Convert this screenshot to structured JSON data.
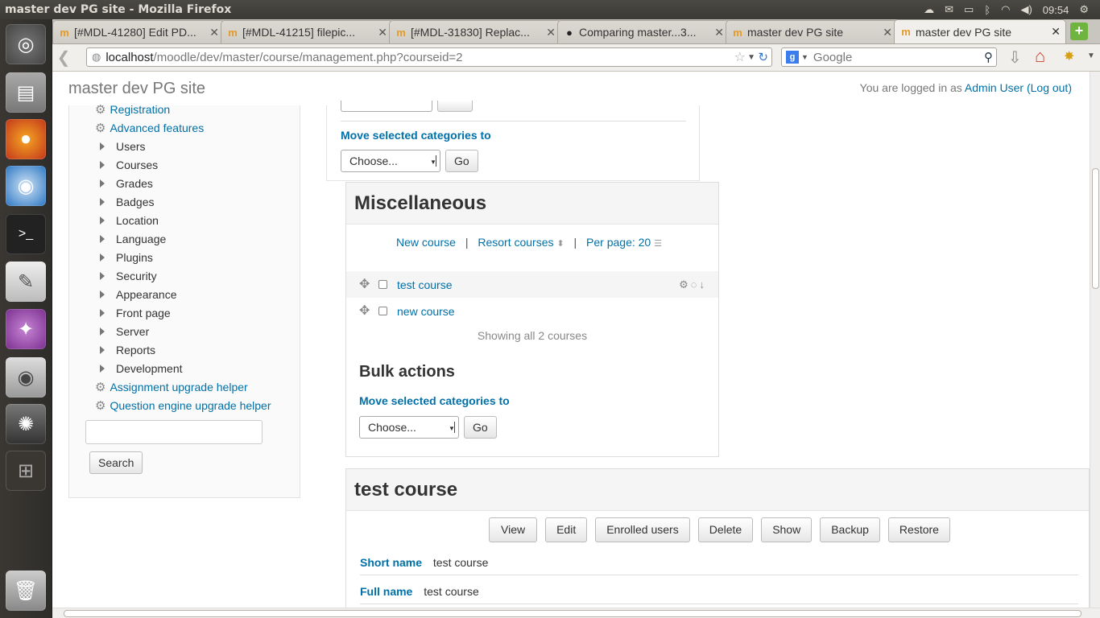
{
  "window": {
    "title": "master dev PG site - Mozilla Firefox"
  },
  "tray": {
    "time": "09:54"
  },
  "tabs": [
    {
      "label": "[#MDL-41280] Edit PD...",
      "icon": "moodle-tracker-icon"
    },
    {
      "label": "[#MDL-41215] filepic...",
      "icon": "moodle-tracker-icon"
    },
    {
      "label": "[#MDL-31830] Replac...",
      "icon": "moodle-tracker-icon"
    },
    {
      "label": "Comparing master...3...",
      "icon": "github-icon"
    },
    {
      "label": "master dev PG site",
      "icon": "moodle-icon"
    },
    {
      "label": "master dev PG site",
      "icon": "moodle-icon",
      "active": true
    }
  ],
  "nav": {
    "url_host": "localhost",
    "url_path": "/moodle/dev/master/course/management.php?courseid=2",
    "search_placeholder": "Google"
  },
  "header": {
    "site_name": "master dev PG site",
    "login_prefix": "You are logged in as ",
    "user": "Admin User",
    "logout": "(Log out)"
  },
  "admin_tree": [
    {
      "label": "Registration",
      "kind": "link"
    },
    {
      "label": "Advanced features",
      "kind": "link"
    },
    {
      "label": "Users",
      "kind": "folder"
    },
    {
      "label": "Courses",
      "kind": "folder"
    },
    {
      "label": "Grades",
      "kind": "folder"
    },
    {
      "label": "Badges",
      "kind": "folder"
    },
    {
      "label": "Location",
      "kind": "folder"
    },
    {
      "label": "Language",
      "kind": "folder"
    },
    {
      "label": "Plugins",
      "kind": "folder"
    },
    {
      "label": "Security",
      "kind": "folder"
    },
    {
      "label": "Appearance",
      "kind": "folder"
    },
    {
      "label": "Front page",
      "kind": "folder"
    },
    {
      "label": "Server",
      "kind": "folder"
    },
    {
      "label": "Reports",
      "kind": "folder"
    },
    {
      "label": "Development",
      "kind": "folder"
    },
    {
      "label": "Assignment upgrade helper",
      "kind": "link"
    },
    {
      "label": "Question engine upgrade helper",
      "kind": "link"
    }
  ],
  "admin_search": {
    "button": "Search"
  },
  "categories_panel": {
    "move_label": "Move selected categories to",
    "select_value": "Choose...",
    "go": "Go"
  },
  "misc_panel": {
    "title": "Miscellaneous",
    "new_course": "New course",
    "resort": "Resort courses",
    "per_page": "Per page: 20",
    "courses": [
      "test course",
      "new course"
    ],
    "showing": "Showing all 2 courses",
    "bulk_title": "Bulk actions",
    "move_label": "Move selected categories to",
    "select_value": "Choose...",
    "go": "Go"
  },
  "detail_panel": {
    "title": "test course",
    "buttons": [
      "View",
      "Edit",
      "Enrolled users",
      "Delete",
      "Show",
      "Backup",
      "Restore"
    ],
    "short_name_label": "Short name",
    "short_name": "test course",
    "full_name_label": "Full name",
    "full_name": "test course"
  }
}
